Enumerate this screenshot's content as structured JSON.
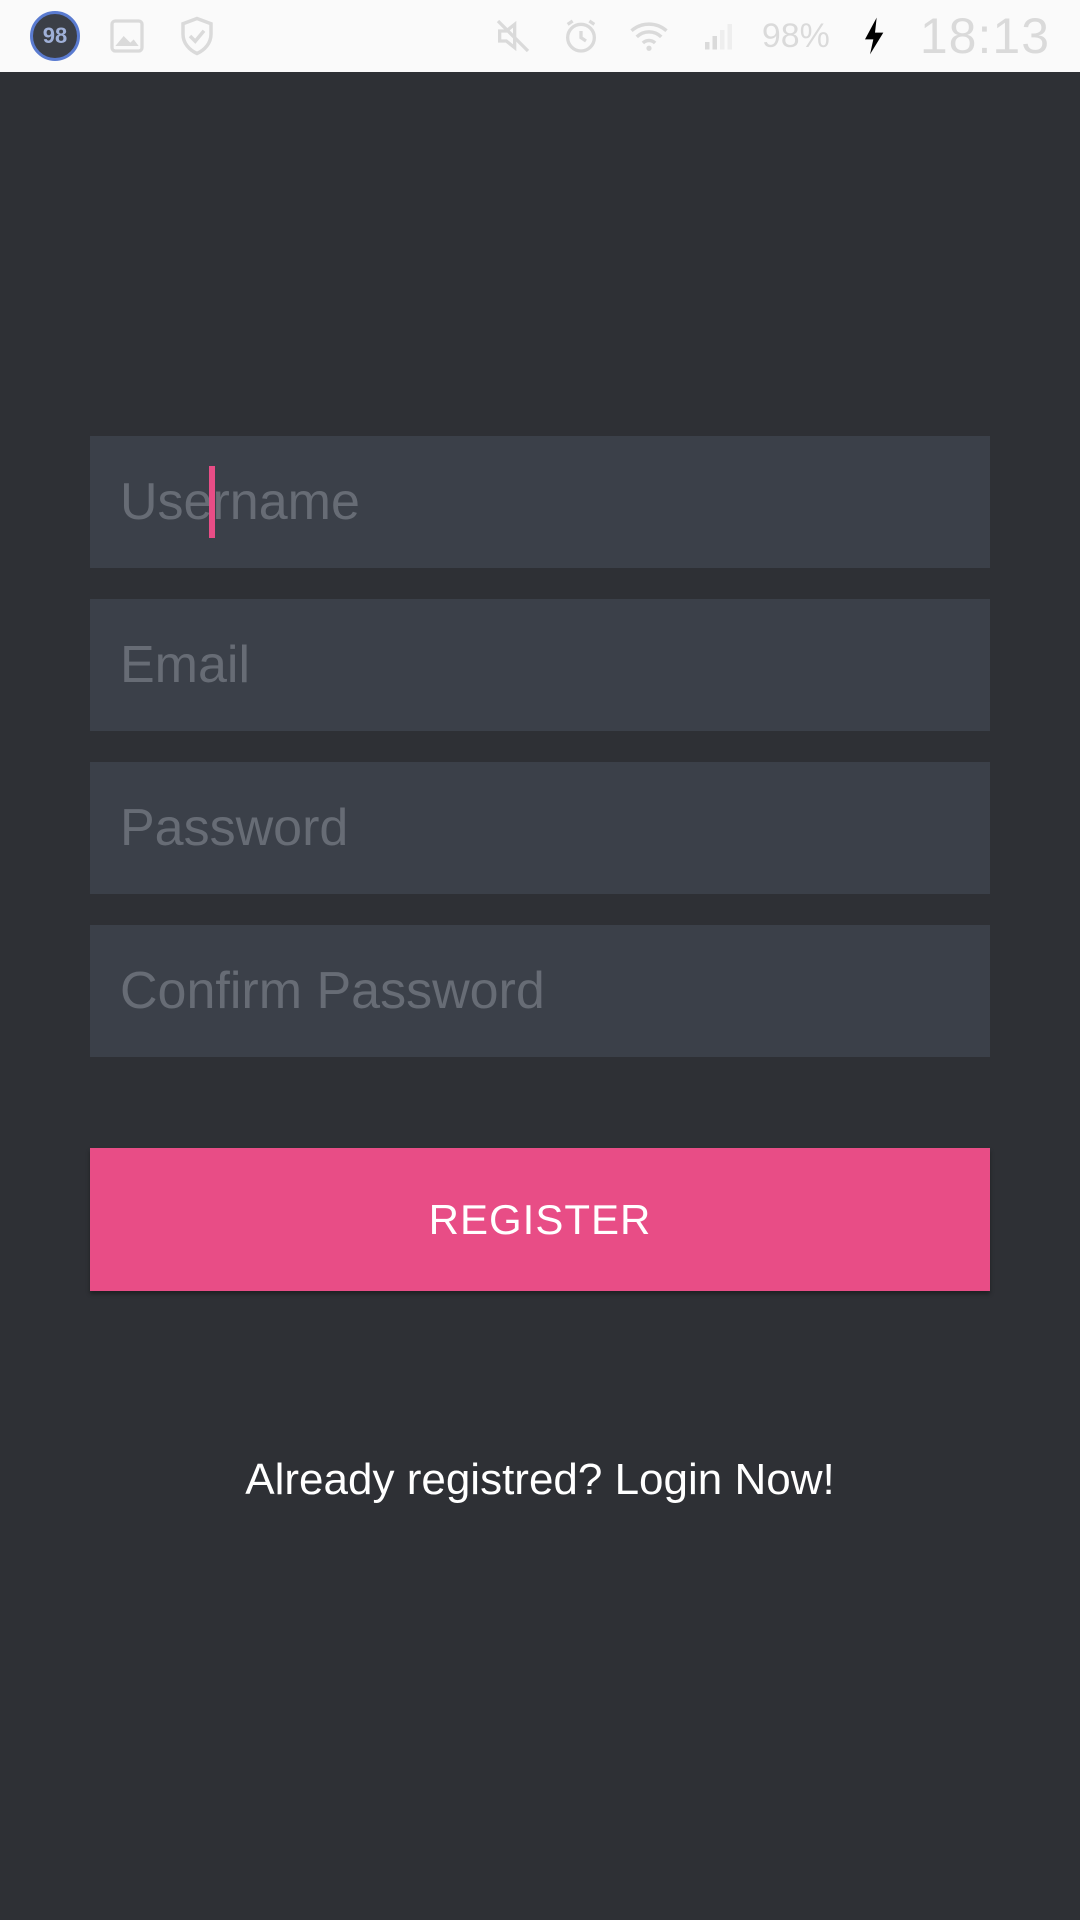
{
  "status_bar": {
    "notification_count": "98",
    "battery_percent": "98%",
    "time": "18:13",
    "icons": [
      "notification-count-badge",
      "image-icon",
      "shield-check-icon",
      "mute-icon",
      "alarm-icon",
      "wifi-icon",
      "signal-icon",
      "battery-charging-icon"
    ]
  },
  "form": {
    "username": {
      "placeholder": "Username",
      "value": ""
    },
    "email": {
      "placeholder": "Email",
      "value": ""
    },
    "password": {
      "placeholder": "Password",
      "value": ""
    },
    "confirm_password": {
      "placeholder": "Confirm Password",
      "value": ""
    }
  },
  "register_button": {
    "label": "REGISTER"
  },
  "login_link": {
    "text": "Already registred? Login Now!"
  },
  "colors": {
    "background": "#2e3035",
    "field_background": "#3b4049",
    "accent": "#e84d86",
    "placeholder": "#676c75"
  }
}
